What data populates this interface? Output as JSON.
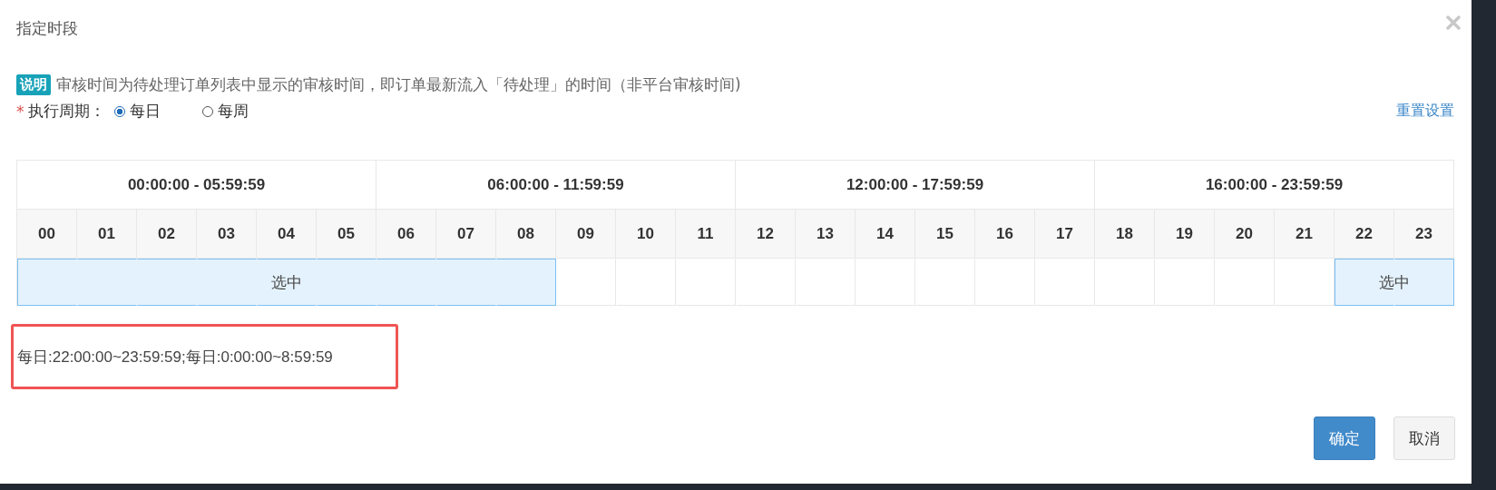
{
  "dialog": {
    "title": "指定时段"
  },
  "note": {
    "badge": "说明",
    "text": "审核时间为待处理订单列表中显示的审核时间，即订单最新流入「待处理」的时间（非平台审核时间)"
  },
  "period": {
    "required_mark": "*",
    "label": "执行周期：",
    "options": [
      {
        "label": "每日",
        "selected": true
      },
      {
        "label": "每周",
        "selected": false
      }
    ],
    "reset_link": "重置设置"
  },
  "table": {
    "ranges": [
      "00:00:00 - 05:59:59",
      "06:00:00 - 11:59:59",
      "12:00:00 - 17:59:59",
      "16:00:00 - 23:59:59"
    ],
    "hours": [
      {
        "label": "00",
        "selected": true
      },
      {
        "label": "01",
        "selected": true
      },
      {
        "label": "02",
        "selected": true
      },
      {
        "label": "03",
        "selected": true
      },
      {
        "label": "04",
        "selected": true
      },
      {
        "label": "05",
        "selected": true
      },
      {
        "label": "06",
        "selected": true
      },
      {
        "label": "07",
        "selected": true
      },
      {
        "label": "08",
        "selected": true
      },
      {
        "label": "09",
        "selected": false
      },
      {
        "label": "10",
        "selected": false
      },
      {
        "label": "11",
        "selected": false
      },
      {
        "label": "12",
        "selected": false
      },
      {
        "label": "13",
        "selected": false
      },
      {
        "label": "14",
        "selected": false
      },
      {
        "label": "15",
        "selected": false
      },
      {
        "label": "16",
        "selected": false
      },
      {
        "label": "17",
        "selected": false
      },
      {
        "label": "18",
        "selected": false
      },
      {
        "label": "19",
        "selected": false
      },
      {
        "label": "20",
        "selected": false
      },
      {
        "label": "21",
        "selected": false
      },
      {
        "label": "22",
        "selected": true
      },
      {
        "label": "23",
        "selected": true
      }
    ],
    "selected_labels": [
      "选中",
      "选中"
    ]
  },
  "summary": "每日:22:00:00~23:59:59;每日:0:00:00~8:59:59",
  "buttons": [
    {
      "label": "确定",
      "kind": "primary"
    },
    {
      "label": "取消",
      "kind": "default"
    }
  ]
}
